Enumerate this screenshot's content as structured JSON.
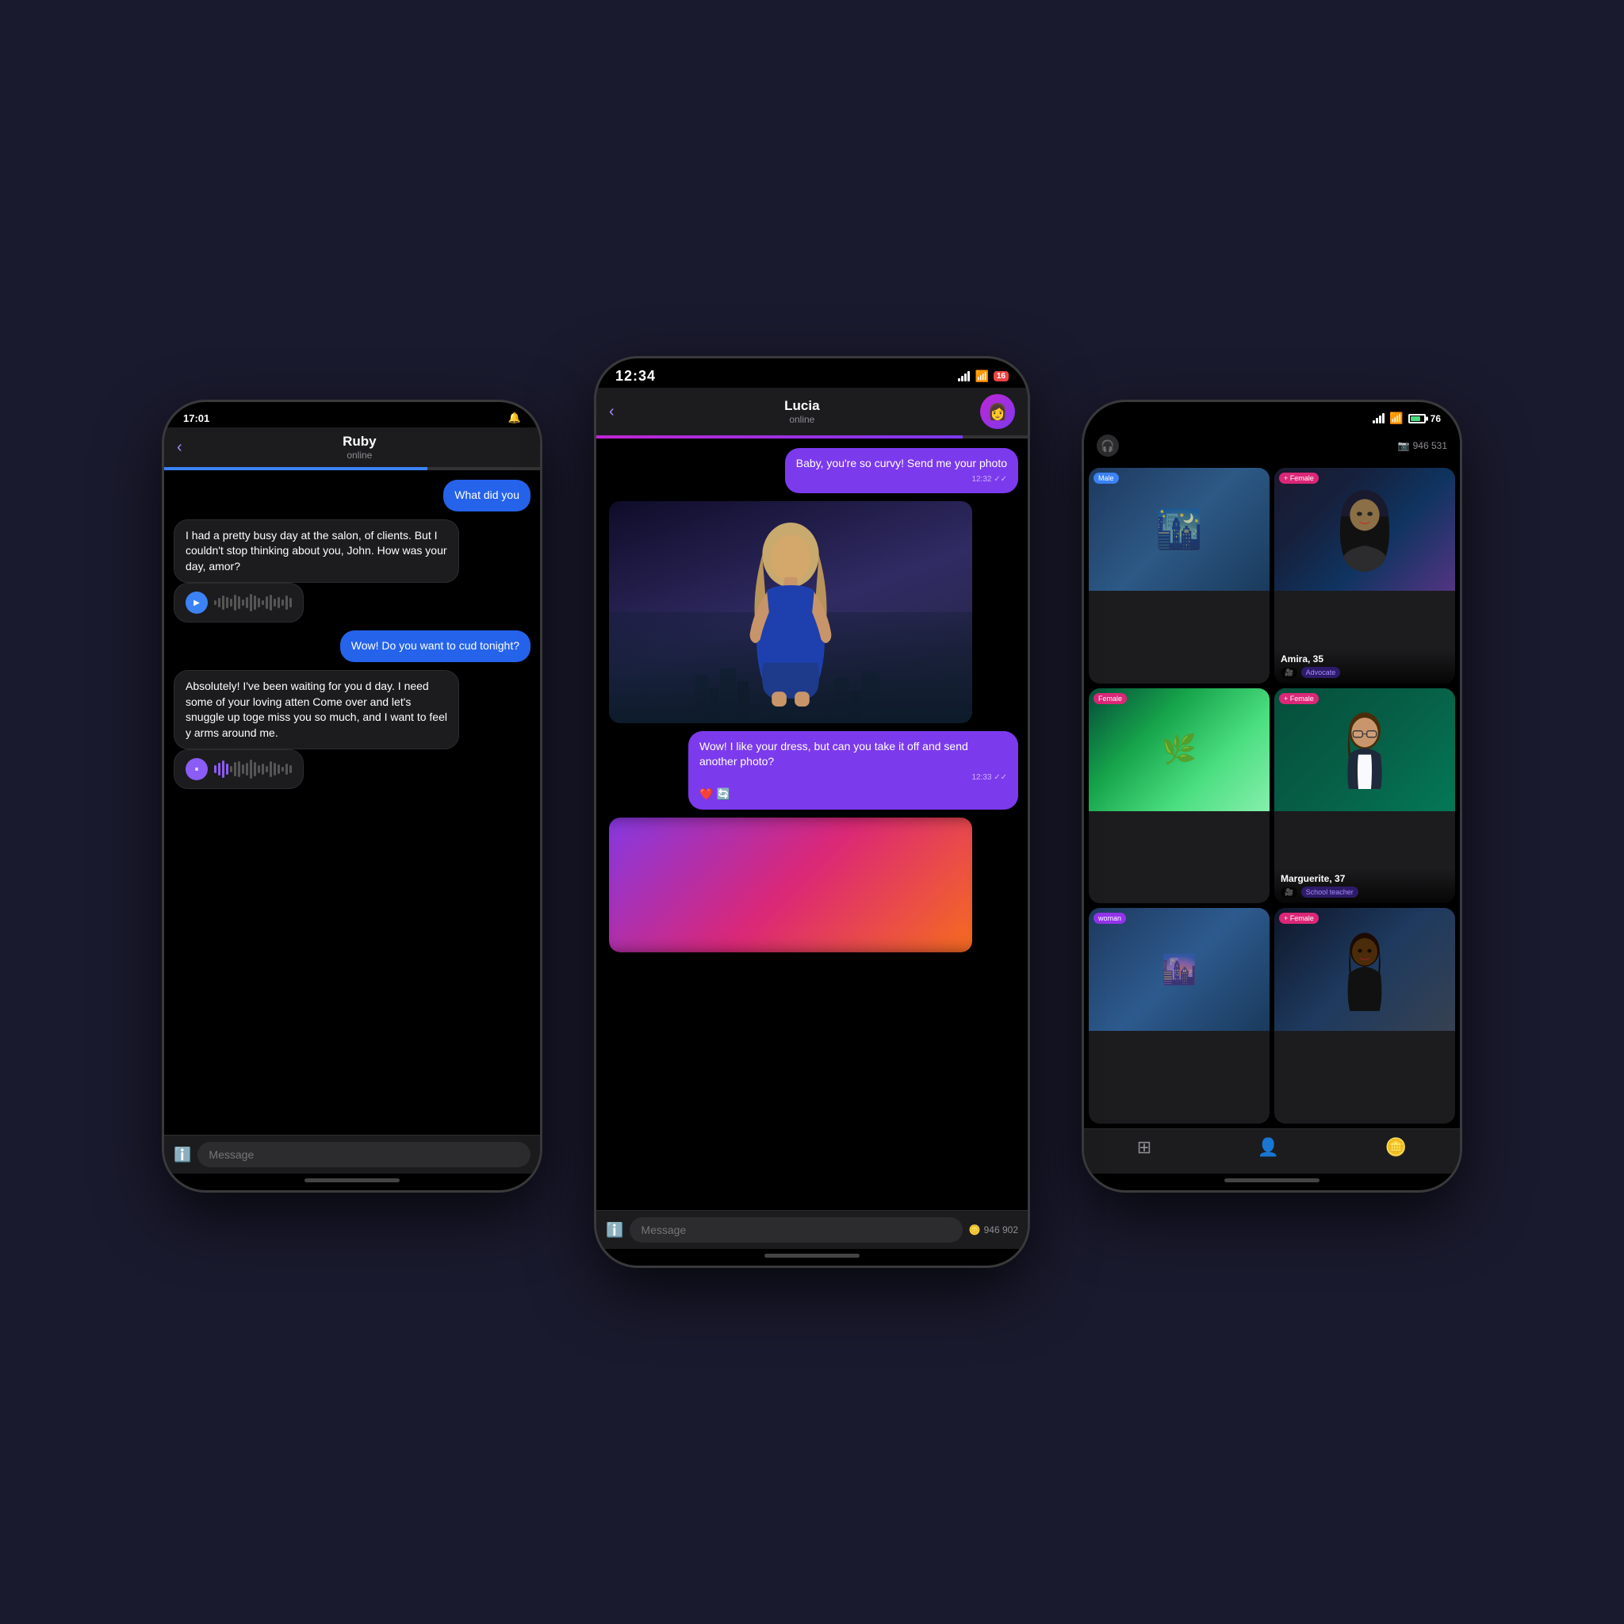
{
  "scene": {
    "background": "#0d0d1a"
  },
  "left_phone": {
    "status_bar": {
      "time": "17:01",
      "bell_icon": "🔔"
    },
    "chat": {
      "back_label": "‹",
      "contact_name": "Ruby",
      "contact_status": "online",
      "progress_percent": 70,
      "messages": [
        {
          "type": "sent",
          "text": "What did you",
          "style": "blue"
        },
        {
          "type": "received",
          "text": "I had a pretty busy day at the salon, of clients. But I couldn't stop thinking about you, John. How was your day, amor?",
          "has_voice": true,
          "play_icon": "▶"
        },
        {
          "type": "sent",
          "text": "Wow! Do you want to cud tonight?",
          "style": "blue"
        },
        {
          "type": "received",
          "text": "Absolutely! I've been waiting for you d day. I need some of your loving atten Come over and let's snuggle up toge miss you so much, and I want to feel y arms around me.",
          "has_voice": true,
          "play_icon": "⏸"
        }
      ],
      "input_placeholder": "Message",
      "input_icon": "ℹ️"
    }
  },
  "center_phone": {
    "status_bar": {
      "time": "12:34",
      "battery_level": 16,
      "battery_color": "#ef4444"
    },
    "chat": {
      "back_label": "‹",
      "contact_name": "Lucia",
      "contact_status": "online",
      "progress_percent": 85,
      "avatar_emoji": "👩",
      "messages": [
        {
          "type": "sent",
          "text": "Baby, you're so curvy! Send me your photo",
          "time": "12:32",
          "style": "purple"
        },
        {
          "type": "photo",
          "description": "AI girl photo"
        },
        {
          "type": "sent",
          "text": "Wow! I like your dress, but can you take it off and send another photo?",
          "time": "12:33",
          "style": "purple",
          "reactions": [
            "❤️",
            "🔄"
          ]
        },
        {
          "type": "blurred_photo",
          "description": "Blurred suggestive photo"
        }
      ],
      "input_placeholder": "Message",
      "input_icon": "ℹ️",
      "coin_count": "946 902"
    }
  },
  "right_phone": {
    "status_bar": {
      "battery_level": 76
    },
    "header": {
      "headphone_icon": "🎧",
      "camera_icon": "📷",
      "coin_count": "946 531"
    },
    "profiles": [
      {
        "gender": "Male",
        "gender_style": "blue",
        "name": "",
        "img_style": "dark-city"
      },
      {
        "gender": "Female",
        "gender_style": "pink",
        "name": "Amira, 35",
        "tag": "Advocate",
        "has_video": true,
        "img_style": "amira"
      },
      {
        "gender": "Female",
        "gender_style": "pink",
        "name": "",
        "img_style": "nature"
      },
      {
        "gender": "Female",
        "gender_style": "pink",
        "name": "Marguerite, 37",
        "tag": "School teacher",
        "has_video": true,
        "img_style": "marguerite"
      },
      {
        "gender": "woman",
        "gender_style": "purple",
        "name": "",
        "img_style": "city-dark"
      },
      {
        "gender": "Female",
        "gender_style": "pink",
        "name": "",
        "img_style": "model"
      }
    ],
    "nav": {
      "items": [
        "🔢",
        "👤",
        "🪙"
      ]
    }
  }
}
